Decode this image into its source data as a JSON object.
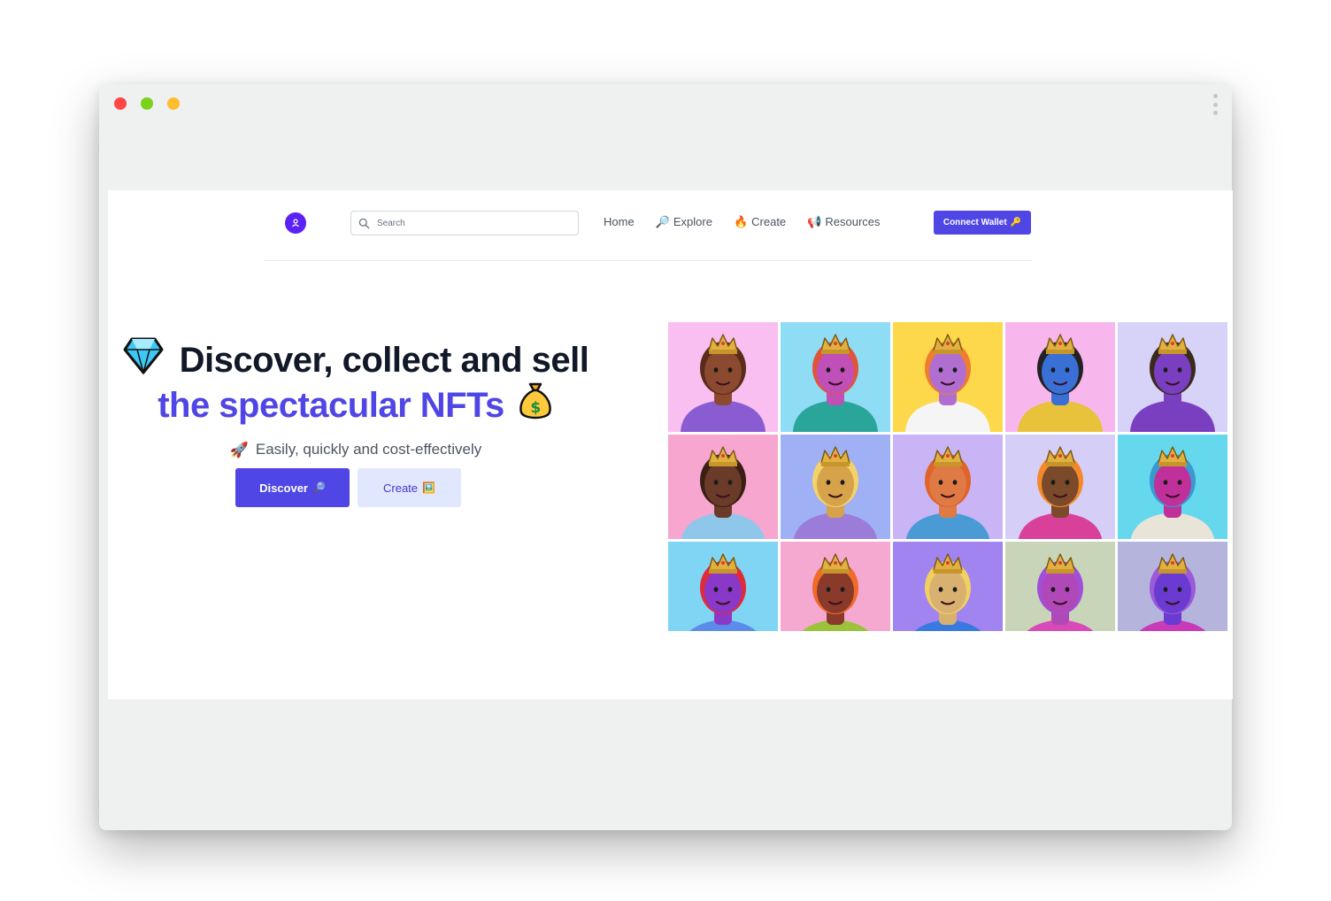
{
  "header": {
    "search_placeholder": "Search",
    "nav": [
      {
        "label": "Home",
        "icon": ""
      },
      {
        "label": "Explore",
        "icon": "🔎"
      },
      {
        "label": "Create",
        "icon": "🔥"
      },
      {
        "label": "Resources",
        "icon": "📢"
      }
    ],
    "connect_label": "Connect Wallet",
    "connect_icon": "🔑"
  },
  "hero": {
    "title_line1": "Discover, collect and sell",
    "title_line2": "the spectacular NFTs",
    "subtitle": "Easily, quickly and cost-effectively",
    "subtitle_icon": "🚀",
    "discover_label": "Discover",
    "discover_icon": "🔎",
    "create_label": "Create",
    "create_icon": "🖼️"
  },
  "colors": {
    "accent": "#4f46e5",
    "accent_light": "#e0e7ff",
    "logo": "#5b21f5",
    "heading": "#111827"
  },
  "gallery": {
    "tiles": [
      {
        "bg": "#f8bff0",
        "skin": "#8b4a2f",
        "hair": "#5a2a1a",
        "shirt": "#8a5cd1"
      },
      {
        "bg": "#8fdcf5",
        "skin": "#c04fb8",
        "hair": "#e0553a",
        "shirt": "#2aa59a"
      },
      {
        "bg": "#fcd84a",
        "skin": "#b06fd0",
        "hair": "#f07c2e",
        "shirt": "#f5f5f5"
      },
      {
        "bg": "#f7b7ec",
        "skin": "#3a6fd6",
        "hair": "#222222",
        "shirt": "#e8c23a"
      },
      {
        "bg": "#d7d2f7",
        "skin": "#7a3fc0",
        "hair": "#3a2a1e",
        "shirt": "#7a3fc0"
      },
      {
        "bg": "#f6a6cf",
        "skin": "#6b3b2a",
        "hair": "#3a1f14",
        "shirt": "#8fc7ea"
      },
      {
        "bg": "#9fb0f5",
        "skin": "#d6a24a",
        "hair": "#f2d36a",
        "shirt": "#9b7cd8"
      },
      {
        "bg": "#c9b5f5",
        "skin": "#e07a45",
        "hair": "#e0632a",
        "shirt": "#4a9ad6"
      },
      {
        "bg": "#d5cff7",
        "skin": "#7a4a2a",
        "hair": "#f5892a",
        "shirt": "#d8409a"
      },
      {
        "bg": "#66d8ee",
        "skin": "#c0309a",
        "hair": "#3a9ad0",
        "shirt": "#e8e4d8"
      },
      {
        "bg": "#7fd5f3",
        "skin": "#8a38c8",
        "hair": "#e02a3a",
        "shirt": "#5a8ce8"
      },
      {
        "bg": "#f5a9d0",
        "skin": "#8a3a2a",
        "hair": "#f06a2a",
        "shirt": "#9bc23a"
      },
      {
        "bg": "#a184f0",
        "skin": "#d8b070",
        "hair": "#f0d060",
        "shirt": "#3a7ae0"
      },
      {
        "bg": "#c9d5b8",
        "skin": "#b048b8",
        "hair": "#a050d8",
        "shirt": "#d84ab8"
      },
      {
        "bg": "#b4b4dc",
        "skin": "#6b3ad0",
        "hair": "#9b5ad8",
        "shirt": "#c83ab8"
      }
    ]
  }
}
